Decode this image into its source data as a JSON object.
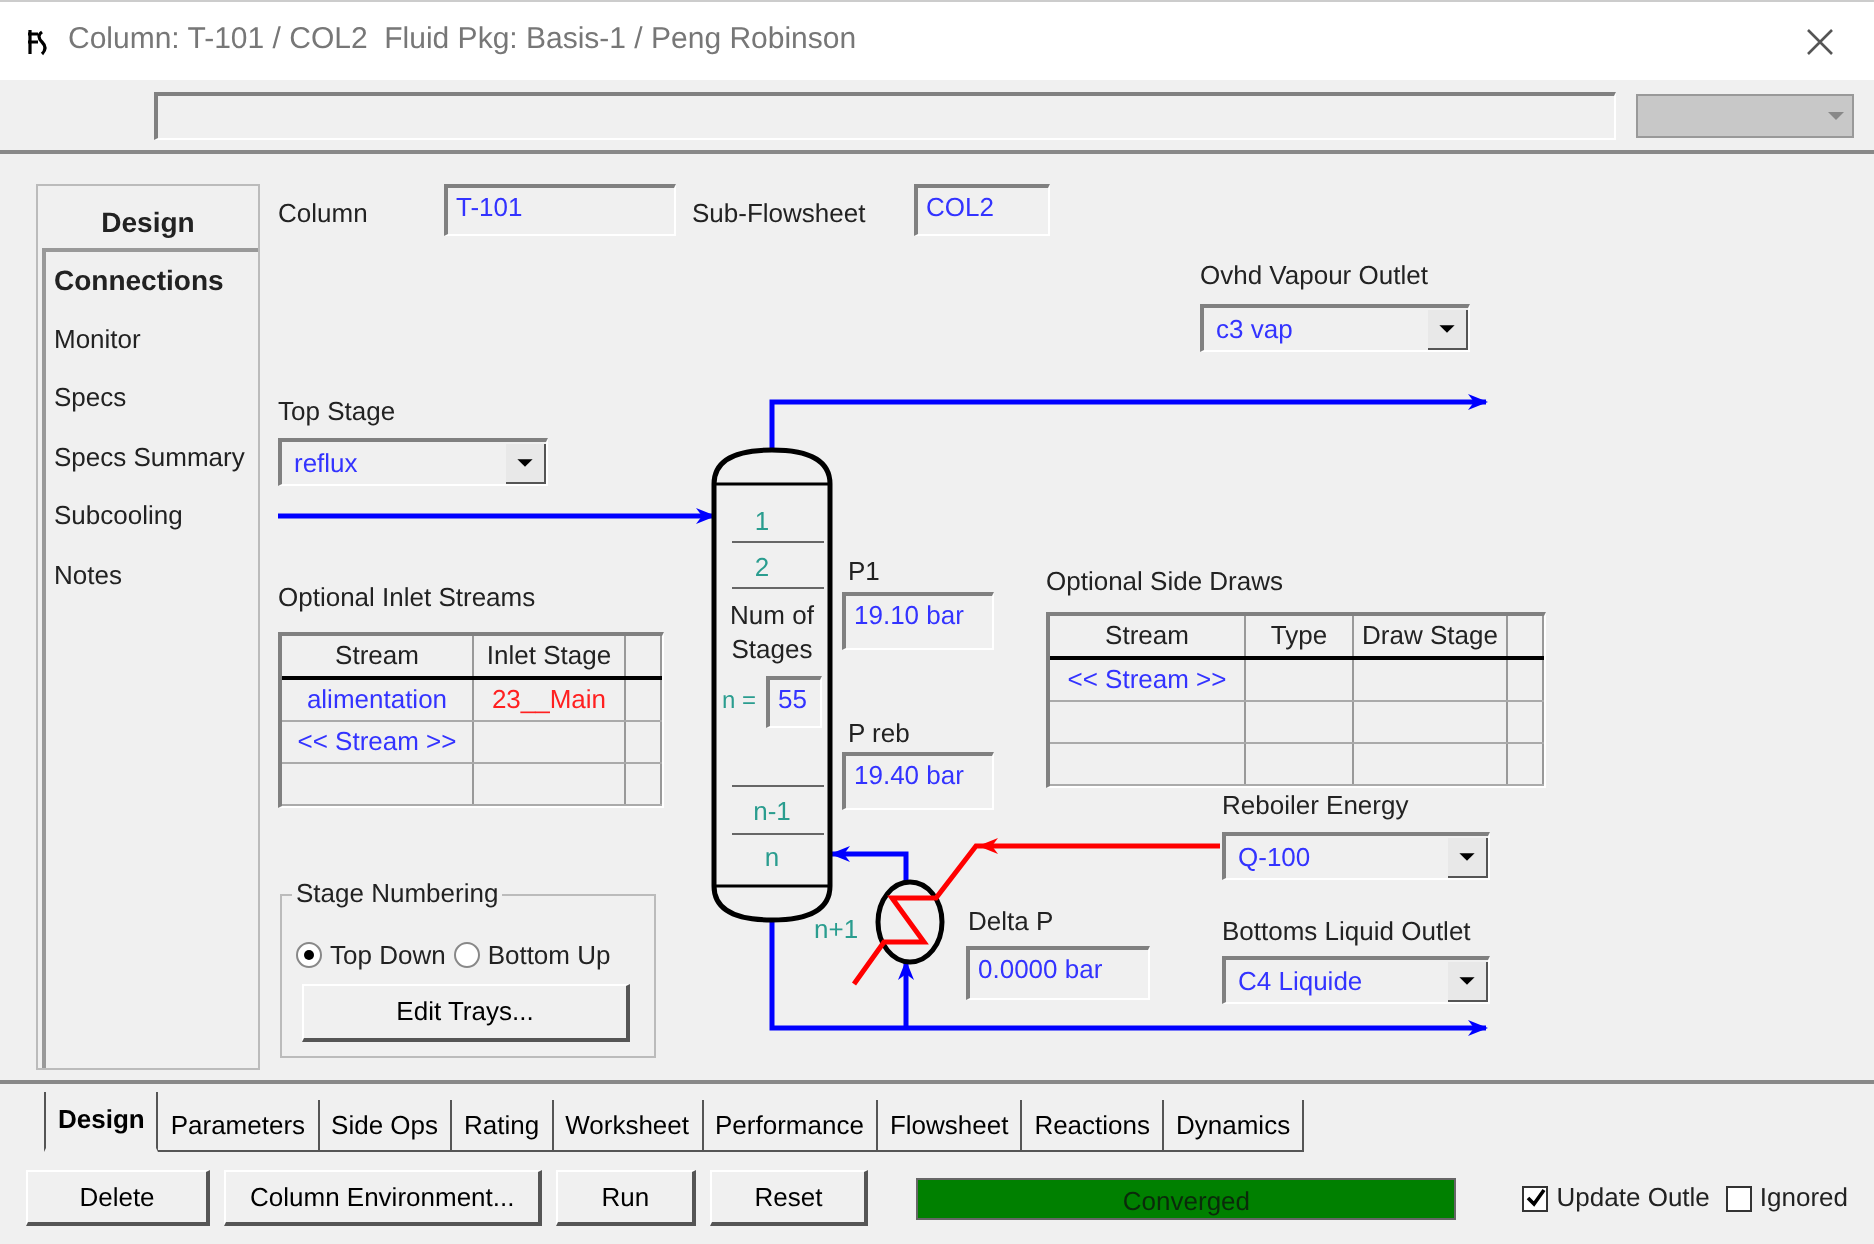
{
  "window": {
    "title": "Column: T-101 / COL2  Fluid Pkg: Basis-1 / Peng Robinson"
  },
  "nav": {
    "header": "Design",
    "items": [
      {
        "label": "Connections",
        "selected": true
      },
      {
        "label": "Monitor",
        "selected": false
      },
      {
        "label": "Specs",
        "selected": false
      },
      {
        "label": "Specs Summary",
        "selected": false
      },
      {
        "label": "Subcooling",
        "selected": false
      },
      {
        "label": "Notes",
        "selected": false
      }
    ]
  },
  "column": {
    "label": "Column",
    "value": "T-101"
  },
  "subflowsheet": {
    "label": "Sub-Flowsheet",
    "value": "COL2"
  },
  "ovhd_vapour_outlet": {
    "label": "Ovhd Vapour Outlet",
    "value": "c3 vap"
  },
  "top_stage": {
    "label": "Top Stage",
    "value": "reflux"
  },
  "inlet_streams": {
    "title": "Optional Inlet Streams",
    "columns": [
      "Stream",
      "Inlet Stage"
    ],
    "rows": [
      [
        "alimentation",
        "23__Main"
      ],
      [
        "<< Stream >>"
      ]
    ]
  },
  "column_diagram": {
    "top_stages": [
      "1",
      "2"
    ],
    "num_stages_label": "Num of Stages",
    "n_label": "n =",
    "n_value": "55",
    "bottom_stages": [
      "n-1",
      "n"
    ],
    "reboiler_stage": "n+1"
  },
  "p1": {
    "label": "P1",
    "value": "19.10 bar"
  },
  "p_reb": {
    "label": "P reb",
    "value": "19.40 bar"
  },
  "side_draws": {
    "title": "Optional Side Draws",
    "columns": [
      "Stream",
      "Type",
      "Draw Stage"
    ],
    "rows": [
      [
        "<< Stream >>"
      ]
    ]
  },
  "reboiler_energy": {
    "label": "Reboiler Energy",
    "value": "Q-100"
  },
  "delta_p": {
    "label": "Delta P",
    "value": "0.0000 bar"
  },
  "bottoms_liquid_outlet": {
    "label": "Bottoms Liquid Outlet",
    "value": "C4 Liquide"
  },
  "stage_numbering": {
    "title": "Stage Numbering",
    "options": [
      {
        "label": "Top Down",
        "selected": true
      },
      {
        "label": "Bottom Up",
        "selected": false
      }
    ],
    "button": "Edit Trays..."
  },
  "tabs": [
    {
      "label": "Design",
      "selected": true
    },
    {
      "label": "Parameters",
      "selected": false
    },
    {
      "label": "Side Ops",
      "selected": false
    },
    {
      "label": "Rating",
      "selected": false
    },
    {
      "label": "Worksheet",
      "selected": false
    },
    {
      "label": "Performance",
      "selected": false
    },
    {
      "label": "Flowsheet",
      "selected": false
    },
    {
      "label": "Reactions",
      "selected": false
    },
    {
      "label": "Dynamics",
      "selected": false
    }
  ],
  "buttons": [
    "Delete",
    "Column Environment...",
    "Run",
    "Reset"
  ],
  "status": {
    "text": "Converged"
  },
  "checkboxes": [
    {
      "label": "Update Outle",
      "checked": true
    },
    {
      "label": "Ignored",
      "checked": false
    }
  ]
}
